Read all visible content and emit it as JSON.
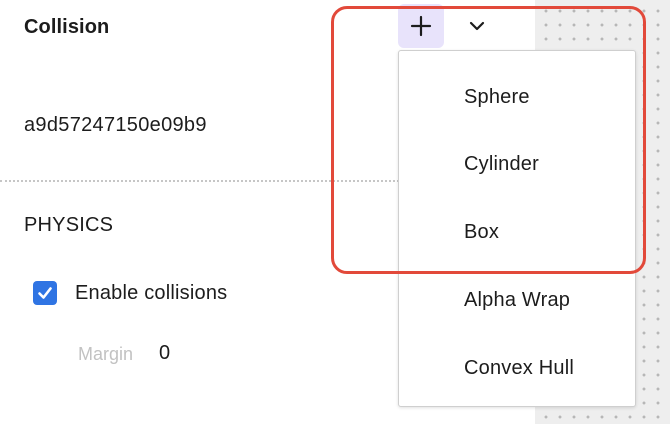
{
  "collision": {
    "title": "Collision",
    "id": "a9d57247150e09b9"
  },
  "toolbar": {
    "add_icon": "plus-icon",
    "dropdown_icon": "chevron-down-icon"
  },
  "physics": {
    "section_title": "PHYSICS",
    "enable_collisions": {
      "label": "Enable collisions",
      "checked": true
    },
    "margin": {
      "label": "Margin",
      "value": "0"
    }
  },
  "dropdown": {
    "items": [
      {
        "label": "Sphere"
      },
      {
        "label": "Cylinder"
      },
      {
        "label": "Box"
      },
      {
        "label": "Alpha Wrap"
      },
      {
        "label": "Convex Hull"
      }
    ]
  },
  "colors": {
    "accent": "#2f74e3",
    "add_button_bg": "#e8e3fb",
    "highlight": "#e2493a"
  }
}
